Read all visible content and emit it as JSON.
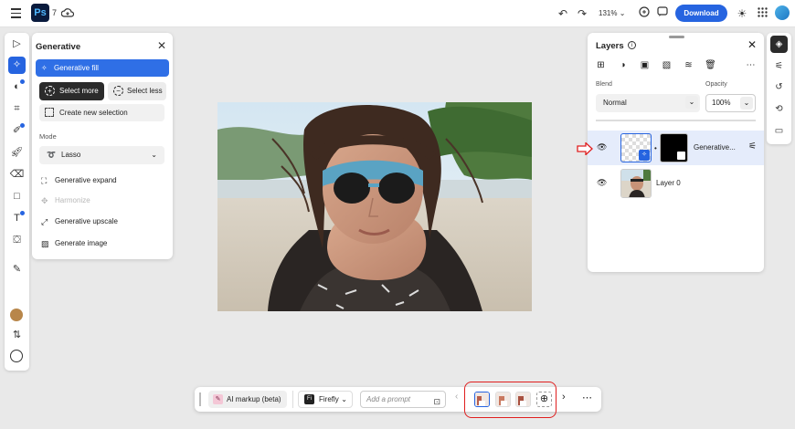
{
  "topbar": {
    "logo": "Ps",
    "version_count": "7",
    "zoom": "131%",
    "download_label": "Download",
    "accent": "#2664e0"
  },
  "generative_panel": {
    "title": "Generative",
    "fill_label": "Generative fill",
    "select_more": "Select more",
    "select_less": "Select less",
    "new_selection": "Create new selection",
    "mode_label": "Mode",
    "mode_value": "Lasso",
    "items": [
      {
        "label": "Generative expand",
        "icon": "expand-icon",
        "disabled": false
      },
      {
        "label": "Harmonize",
        "icon": "harmonize-icon",
        "disabled": true
      },
      {
        "label": "Generative upscale",
        "icon": "upscale-icon",
        "disabled": false
      },
      {
        "label": "Generate image",
        "icon": "image-icon",
        "disabled": false
      }
    ]
  },
  "layers_panel": {
    "title": "Layers",
    "blend_label": "Blend",
    "blend_value": "Normal",
    "opacity_label": "Opacity",
    "opacity_value": "100%",
    "layers": [
      {
        "name": "Generative...",
        "selected": true
      },
      {
        "name": "Layer 0",
        "selected": false
      }
    ]
  },
  "taskbar": {
    "ai_markup": "AI markup (beta)",
    "model": "Firefly",
    "prompt_placeholder": "Add a prompt"
  },
  "swatches": {
    "foreground": "#b8864a",
    "background": "#ffffff"
  }
}
